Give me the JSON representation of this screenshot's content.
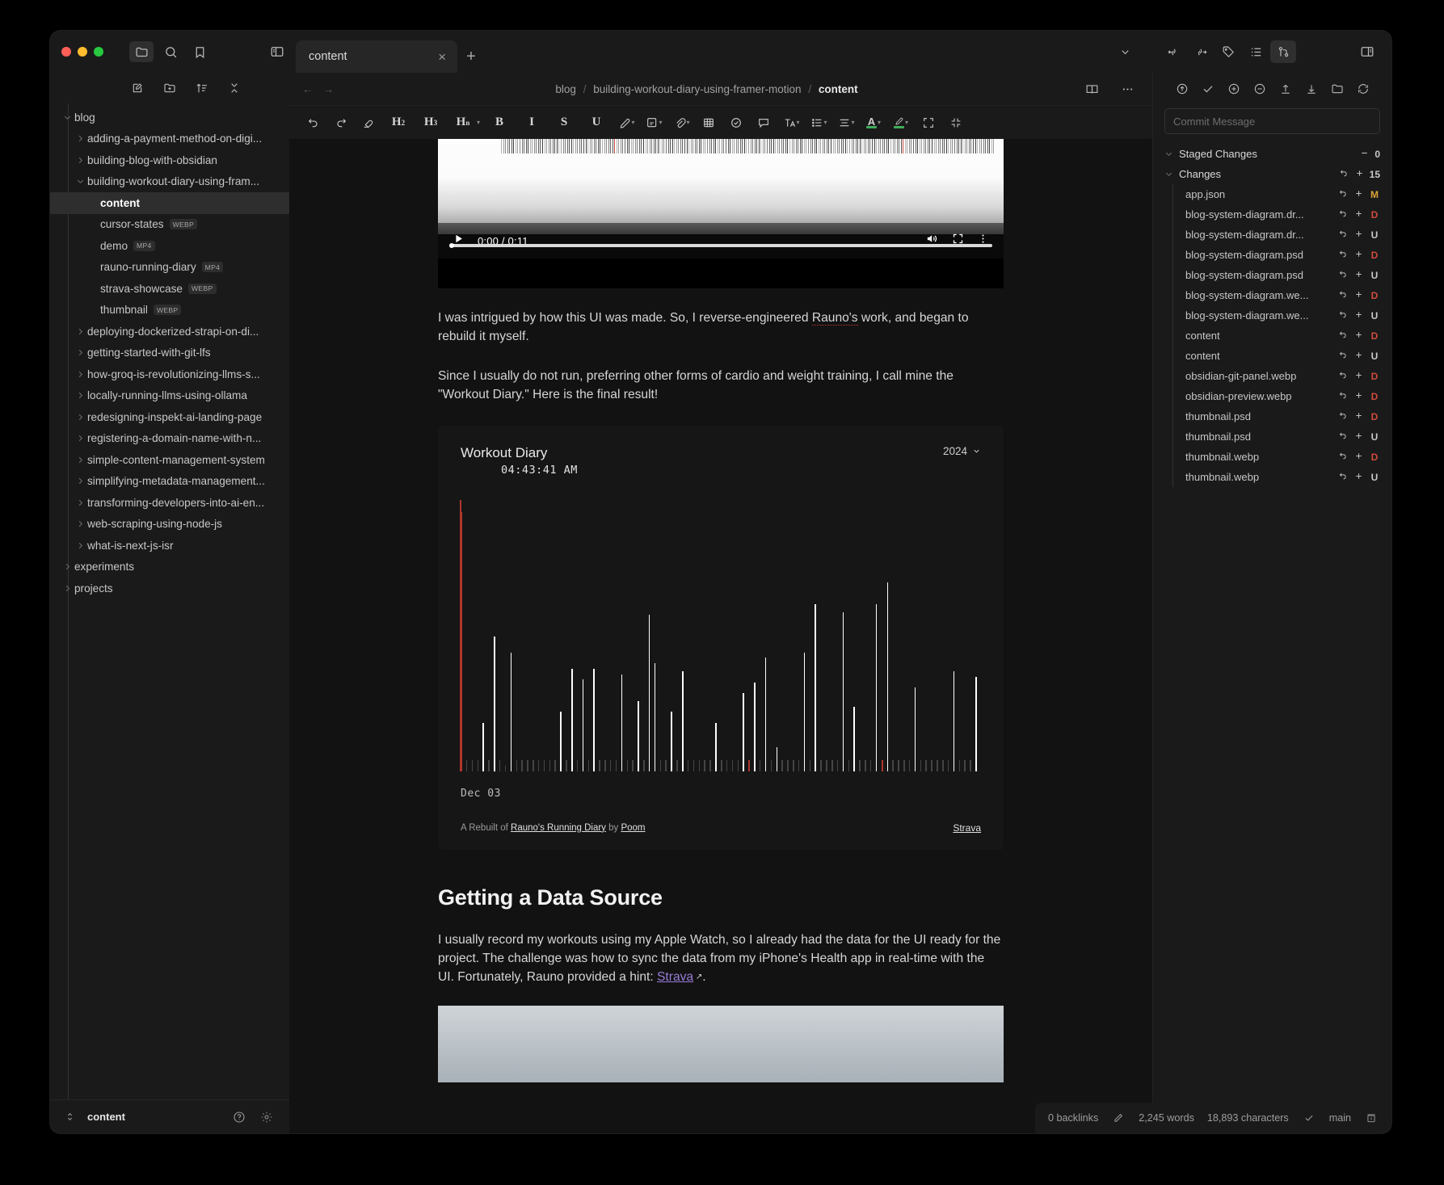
{
  "window": {
    "traffic_lights": [
      "close",
      "minimize",
      "maximize"
    ]
  },
  "titlebar": {
    "left_icons": [
      "folder-icon",
      "search-icon",
      "bookmark-icon",
      "sidebar-toggle-icon"
    ],
    "right_icons": [
      "chevron-down-icon",
      "backlink-icon",
      "outgoing-link-icon",
      "tag-icon",
      "outline-icon",
      "git-icon",
      "right-sidebar-toggle-icon"
    ],
    "tab": {
      "label": "content",
      "close": "×"
    },
    "new_tab": "+"
  },
  "sidebar": {
    "tool_icons": [
      "new-note-icon",
      "new-folder-icon",
      "sort-icon",
      "collapse-all-icon"
    ],
    "tree": [
      {
        "label": "blog",
        "level": 0,
        "twisty": "down"
      },
      {
        "label": "adding-a-payment-method-on-digi...",
        "level": 1,
        "twisty": "right"
      },
      {
        "label": "building-blog-with-obsidian",
        "level": 1,
        "twisty": "right"
      },
      {
        "label": "building-workout-diary-using-fram...",
        "level": 1,
        "twisty": "down"
      },
      {
        "label": "content",
        "level": 2,
        "twisty": "none",
        "selected": true
      },
      {
        "label": "cursor-states",
        "level": 2,
        "twisty": "none",
        "badge": "WEBP"
      },
      {
        "label": "demo",
        "level": 2,
        "twisty": "none",
        "badge": "MP4"
      },
      {
        "label": "rauno-running-diary",
        "level": 2,
        "twisty": "none",
        "badge": "MP4"
      },
      {
        "label": "strava-showcase",
        "level": 2,
        "twisty": "none",
        "badge": "WEBP"
      },
      {
        "label": "thumbnail",
        "level": 2,
        "twisty": "none",
        "badge": "WEBP"
      },
      {
        "label": "deploying-dockerized-strapi-on-di...",
        "level": 1,
        "twisty": "right"
      },
      {
        "label": "getting-started-with-git-lfs",
        "level": 1,
        "twisty": "right"
      },
      {
        "label": "how-groq-is-revolutionizing-llms-s...",
        "level": 1,
        "twisty": "right"
      },
      {
        "label": "locally-running-llms-using-ollama",
        "level": 1,
        "twisty": "right"
      },
      {
        "label": "redesigning-inspekt-ai-landing-page",
        "level": 1,
        "twisty": "right"
      },
      {
        "label": "registering-a-domain-name-with-n...",
        "level": 1,
        "twisty": "right"
      },
      {
        "label": "simple-content-management-system",
        "level": 1,
        "twisty": "right"
      },
      {
        "label": "simplifying-metadata-management...",
        "level": 1,
        "twisty": "right"
      },
      {
        "label": "transforming-developers-into-ai-en...",
        "level": 1,
        "twisty": "right"
      },
      {
        "label": "web-scraping-using-node-js",
        "level": 1,
        "twisty": "right"
      },
      {
        "label": "what-is-next-js-isr",
        "level": 1,
        "twisty": "right"
      },
      {
        "label": "experiments",
        "level": 0,
        "twisty": "right"
      },
      {
        "label": "projects",
        "level": 0,
        "twisty": "right"
      }
    ],
    "status": {
      "file": "content",
      "icons": [
        "help-icon",
        "settings-icon"
      ]
    }
  },
  "editor": {
    "breadcrumb": {
      "back": "←",
      "forward": "→",
      "crumbs": [
        "blog",
        "building-workout-diary-using-framer-motion"
      ],
      "current": "content",
      "right_icons": [
        "reading-view-icon",
        "more-options-icon"
      ]
    },
    "toolbar": [
      {
        "name": "undo-icon",
        "glyph": "↶"
      },
      {
        "name": "redo-icon",
        "glyph": "↷"
      },
      {
        "name": "clear-format-icon",
        "glyph": "⌧"
      },
      {
        "name": "heading-2-button",
        "text": "H",
        "sub": "2"
      },
      {
        "name": "heading-3-button",
        "text": "H",
        "sub": "3"
      },
      {
        "name": "heading-n-button",
        "text": "H",
        "sub": "n"
      },
      {
        "name": "bold-button",
        "text": "B"
      },
      {
        "name": "italic-button",
        "text": "I"
      },
      {
        "name": "strikethrough-button",
        "text": "S"
      },
      {
        "name": "underline-button",
        "text": "U"
      },
      {
        "name": "highlight-icon",
        "glyph": "✐"
      },
      {
        "name": "edit-note-icon",
        "glyph": "✎"
      },
      {
        "name": "attachment-icon",
        "glyph": "📎"
      },
      {
        "name": "table-icon",
        "glyph": "▦"
      },
      {
        "name": "checklist-icon",
        "glyph": "✓"
      },
      {
        "name": "callout-icon",
        "glyph": "▢"
      },
      {
        "name": "text-style-icon",
        "glyph": "T"
      },
      {
        "name": "bullet-list-icon",
        "glyph": "≡"
      },
      {
        "name": "align-icon",
        "glyph": "≡"
      },
      {
        "name": "font-color-icon",
        "glyph": "A"
      },
      {
        "name": "highlight-color-icon",
        "glyph": "◢"
      },
      {
        "name": "expand-icon",
        "glyph": "⛶"
      },
      {
        "name": "collapse-icon",
        "glyph": "⤨"
      }
    ],
    "video": {
      "current_time": "0:00",
      "duration": "0:11",
      "separator": "/",
      "controls": [
        "play-button",
        "volume-button",
        "fullscreen-button",
        "more-menu-button"
      ]
    },
    "paragraphs": [
      "I was intrigued by how this UI was made. So, I reverse-engineered Rauno's work, and began to rebuild it myself.",
      "Since I usually do not run, preferring other forms of cardio and weight training, I call mine the \"Workout Diary.\" Here is the final result!"
    ],
    "section_heading": "Getting a Data Source",
    "paragraph3_a": "I usually record my workouts using my Apple Watch, so I already had the data for the UI ready for the project. The challenge was how to sync the data from my iPhone's Health app in real-time with the UI. Fortunately, Rauno provided a hint: ",
    "paragraph3_link": "Strava",
    "paragraph3_b": "."
  },
  "chart_data": {
    "type": "bar",
    "title": "Workout Diary",
    "subtitle": "04:43:41 AM",
    "year_selector": "2024",
    "xlabel_tick": "Dec 03",
    "xlabel": "",
    "ylabel": "",
    "grid": false,
    "legend": null,
    "footer_prefix": "A Rebuilt of ",
    "footer_link1": "Rauno's Running Diary",
    "footer_by": " by ",
    "footer_link2": "Poom",
    "footer_right": "Strava",
    "marker_index": 0,
    "highlight_color": "#b0362c",
    "bar_color": "#ffffff",
    "baseline_color": "#6d6d6d",
    "ylim": [
      0,
      100
    ],
    "values": [
      96,
      4,
      4,
      4,
      18,
      4,
      50,
      4,
      2,
      44,
      4,
      4,
      4,
      4,
      4,
      4,
      4,
      4,
      22,
      4,
      38,
      4,
      34,
      4,
      38,
      4,
      4,
      4,
      4,
      36,
      4,
      4,
      26,
      4,
      58,
      40,
      4,
      4,
      22,
      4,
      37,
      4,
      4,
      4,
      4,
      4,
      18,
      4,
      4,
      4,
      4,
      29,
      4,
      33,
      4,
      42,
      4,
      9,
      4,
      4,
      4,
      4,
      44,
      4,
      62,
      4,
      4,
      4,
      4,
      59,
      4,
      24,
      4,
      4,
      4,
      62,
      4,
      70,
      4,
      4,
      4,
      4,
      31,
      4,
      4,
      4,
      4,
      4,
      4,
      37,
      4,
      4,
      4,
      35
    ]
  },
  "git_panel": {
    "toolbar_icons": [
      "commit-push-icon",
      "commit-icon",
      "stage-all-icon",
      "unstage-all-icon",
      "push-icon",
      "pull-icon",
      "open-repo-icon",
      "refresh-icon"
    ],
    "commit_placeholder": "Commit Message",
    "sections": [
      {
        "label": "Staged Changes",
        "twisty": "down",
        "icons": [
          "minus-icon"
        ],
        "count": "0"
      },
      {
        "label": "Changes",
        "twisty": "down",
        "icons": [
          "discard-icon",
          "stage-icon"
        ],
        "count": "15"
      }
    ],
    "files": [
      {
        "name": "app.json",
        "status": "M"
      },
      {
        "name": "blog-system-diagram.dr...",
        "status": "D"
      },
      {
        "name": "blog-system-diagram.dr...",
        "status": "U"
      },
      {
        "name": "blog-system-diagram.psd",
        "status": "D"
      },
      {
        "name": "blog-system-diagram.psd",
        "status": "U"
      },
      {
        "name": "blog-system-diagram.we...",
        "status": "D"
      },
      {
        "name": "blog-system-diagram.we...",
        "status": "U"
      },
      {
        "name": "content",
        "status": "D"
      },
      {
        "name": "content",
        "status": "U"
      },
      {
        "name": "obsidian-git-panel.webp",
        "status": "D"
      },
      {
        "name": "obsidian-preview.webp",
        "status": "D"
      },
      {
        "name": "thumbnail.psd",
        "status": "D"
      },
      {
        "name": "thumbnail.psd",
        "status": "U"
      },
      {
        "name": "thumbnail.webp",
        "status": "D"
      },
      {
        "name": "thumbnail.webp",
        "status": "U"
      }
    ]
  },
  "statusbar": {
    "backlinks": "0 backlinks",
    "words": "2,245 words",
    "characters": "18,893 characters",
    "branch": "main",
    "icons": [
      "pencil-icon",
      "check-icon",
      "vault-icon"
    ]
  }
}
